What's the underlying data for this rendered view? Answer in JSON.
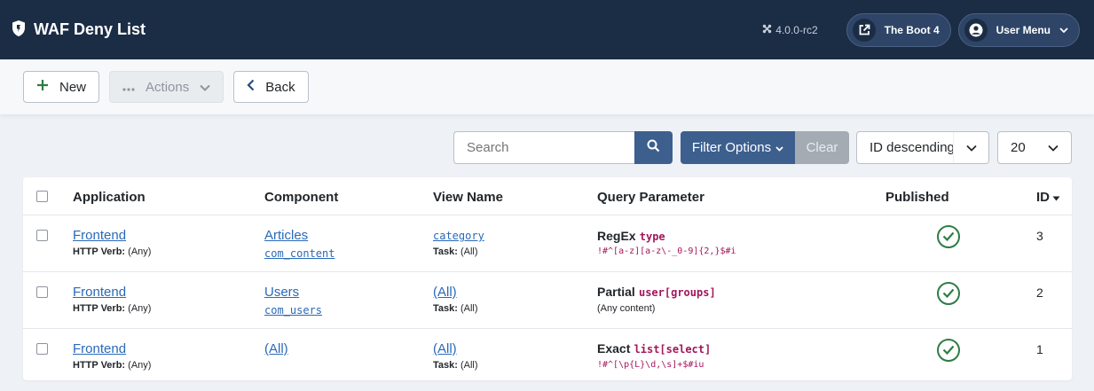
{
  "header": {
    "title": "WAF Deny List",
    "version": "4.0.0-rc2",
    "site_button": "The Boot 4",
    "user_menu": "User Menu"
  },
  "toolbar": {
    "new_label": "New",
    "actions_label": "Actions",
    "back_label": "Back"
  },
  "filters": {
    "search_placeholder": "Search",
    "filter_options_label": "Filter Options",
    "clear_label": "Clear",
    "ordering_value": "ID descending",
    "limit_value": "20"
  },
  "table": {
    "columns": {
      "application": "Application",
      "component": "Component",
      "view": "View Name",
      "query": "Query Parameter",
      "published": "Published",
      "id": "ID"
    },
    "verb_label": "HTTP Verb:",
    "task_label": "Task:",
    "rows": [
      {
        "application": "Frontend",
        "verb": "(Any)",
        "component": "Articles",
        "component_code": "com_content",
        "view": "category",
        "task": "(All)",
        "query_type": "RegEx",
        "query_param": "type",
        "query_value": "!#^[a-z][a-z\\-_0-9]{2,}$#i",
        "id": "3"
      },
      {
        "application": "Frontend",
        "verb": "(Any)",
        "component": "Users",
        "component_code": "com_users",
        "view": "(All)",
        "task": "(All)",
        "query_type": "Partial",
        "query_param": "user[groups]",
        "query_value": "(Any content)",
        "id": "2"
      },
      {
        "application": "Frontend",
        "verb": "(Any)",
        "component": "(All)",
        "component_code": "",
        "view": "(All)",
        "task": "(All)",
        "query_type": "Exact",
        "query_param": "list[select]",
        "query_value": "!#^[\\p{L}\\d,\\s]+$#iu",
        "id": "1"
      }
    ]
  },
  "colors": {
    "header_bg": "#1b2c45",
    "primary": "#3d5f8e",
    "link": "#2a69b8",
    "published": "#2e7d45",
    "code": "#a3175b"
  }
}
